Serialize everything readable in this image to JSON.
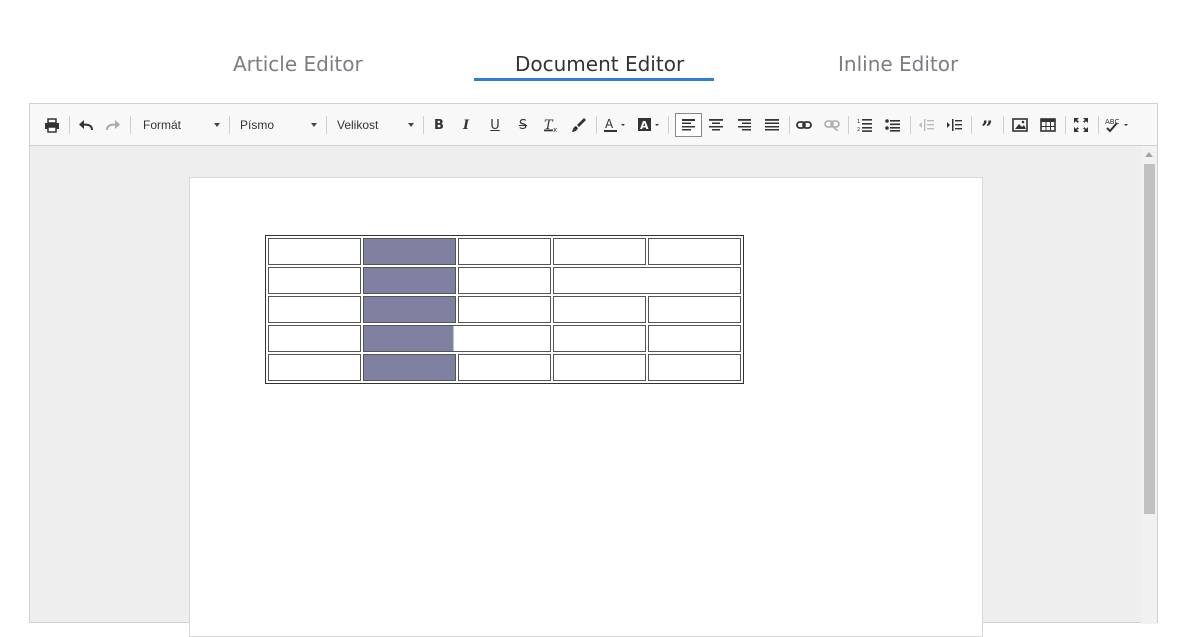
{
  "tabs": [
    {
      "label": "Article Editor",
      "active": false
    },
    {
      "label": "Document Editor",
      "active": true
    },
    {
      "label": "Inline Editor",
      "active": false
    }
  ],
  "toolbar": {
    "format_label": "Formát",
    "font_label": "Písmo",
    "size_label": "Velikost",
    "icons": [
      "print-icon",
      "undo-icon",
      "redo-icon",
      "bold-icon",
      "italic-icon",
      "underline-icon",
      "strikethrough-icon",
      "remove-format-icon",
      "copy-format-icon",
      "text-color-icon",
      "background-color-icon",
      "align-left-icon",
      "align-center-icon",
      "align-right-icon",
      "align-justify-icon",
      "link-icon",
      "unlink-icon",
      "numbered-list-icon",
      "bulleted-list-icon",
      "outdent-icon",
      "indent-icon",
      "blockquote-icon",
      "image-icon",
      "table-icon",
      "maximize-icon",
      "spellcheck-icon"
    ]
  },
  "colors": {
    "accent": "#2c7ed6",
    "selection": "#8080a0"
  }
}
